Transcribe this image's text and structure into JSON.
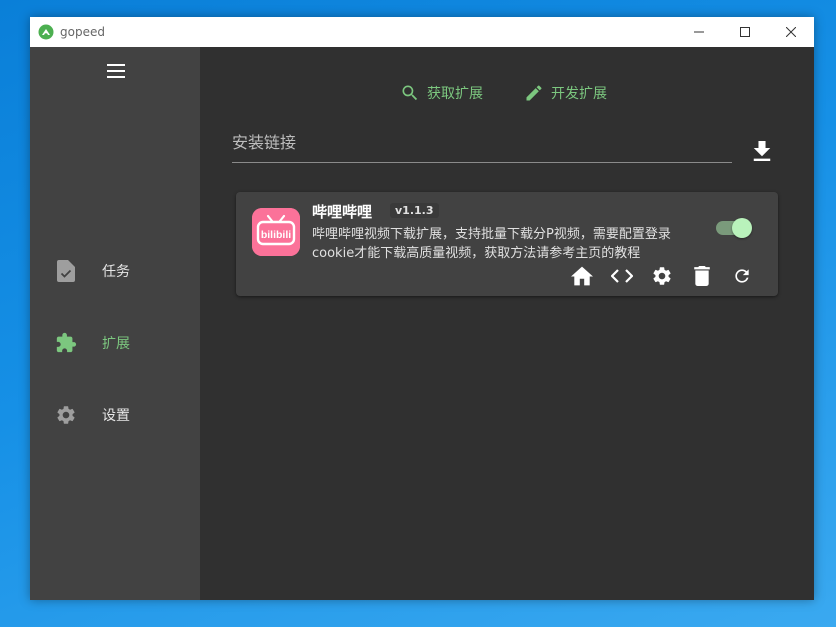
{
  "window": {
    "app_title": "gopeed"
  },
  "sidebar": {
    "items": [
      {
        "label": "任务",
        "icon": "task-icon",
        "active": false
      },
      {
        "label": "扩展",
        "icon": "extension-icon",
        "active": true
      },
      {
        "label": "设置",
        "icon": "settings-icon",
        "active": false
      }
    ]
  },
  "main": {
    "actions": {
      "get_extension": "获取扩展",
      "develop_extension": "开发扩展"
    },
    "install": {
      "placeholder": "安装链接"
    },
    "extension": {
      "title": "哔哩哔哩",
      "version": "v1.1.3",
      "description": "哔哩哔哩视频下载扩展，支持批量下载分P视频，需要配置登录cookie才能下载高质量视频，获取方法请参考主页的教程",
      "enabled": true,
      "icon_text": "bilibili"
    }
  },
  "colors": {
    "accent": "#7cc77f",
    "sidebar_bg": "#424242",
    "main_bg": "#303030",
    "card_bg": "#424242",
    "bilibili_pink": "#fb7299"
  }
}
